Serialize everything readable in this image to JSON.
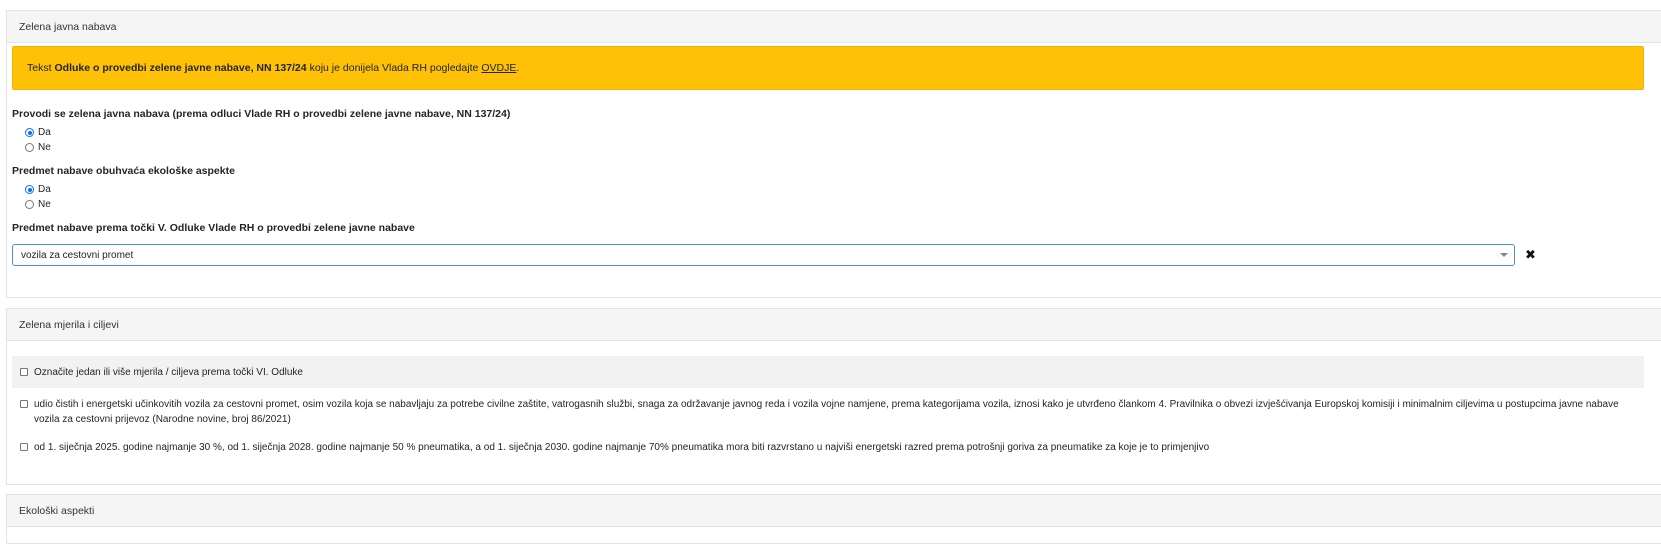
{
  "section1": {
    "title": "Zelena javna nabava",
    "alert": {
      "prefix": "Tekst",
      "bold": "Odluke o provedbi zelene javne nabave, NN 137/24",
      "middle": "koju je donijela Vlada RH pogledajte",
      "link": "OVDJE",
      "suffix": "."
    },
    "q1": {
      "label": "Provodi se zelena javna nabava (prema odluci Vlade RH o provedbi zelene javne nabave, NN 137/24)",
      "options": [
        "Da",
        "Ne"
      ],
      "selected": "Da"
    },
    "q2": {
      "label": "Predmet nabave obuhvaća ekološke aspekte",
      "options": [
        "Da",
        "Ne"
      ],
      "selected": "Da"
    },
    "q3": {
      "label": "Predmet nabave prema točki V. Odluke Vlade RH o provedbi zelene javne nabave",
      "value": "vozila za cestovni promet"
    }
  },
  "section2": {
    "title": "Zelena mjerila i ciljevi",
    "select_all": "Označite jedan ili više mjerila / ciljeva prema točki VI. Odluke",
    "criteria": [
      "udio čistih i energetski učinkovitih vozila za cestovni promet, osim vozila koja se nabavljaju za potrebe civilne zaštite, vatrogasnih službi, snaga za održavanje javnog reda i vozila vojne namjene, prema kategorijama vozila, iznosi kako je utvrđeno člankom 4. Pravilnika o obvezi izvješćivanja Europskoj komisiji i minimalnim ciljevima u postupcima javne nabave vozila za cestovni prijevoz (Narodne novine, broj 86/2021)",
      "od 1. siječnja 2025. godine najmanje 30 %, od 1. siječnja 2028. godine najmanje 50 % pneumatika, a od 1. siječnja 2030. godine najmanje 70% pneumatika mora biti razvrstano u najviši energetski razred prema potrošnji goriva za pneumatike za koje je to primjenjivo"
    ]
  },
  "section3": {
    "title": "Ekološki aspekti"
  }
}
